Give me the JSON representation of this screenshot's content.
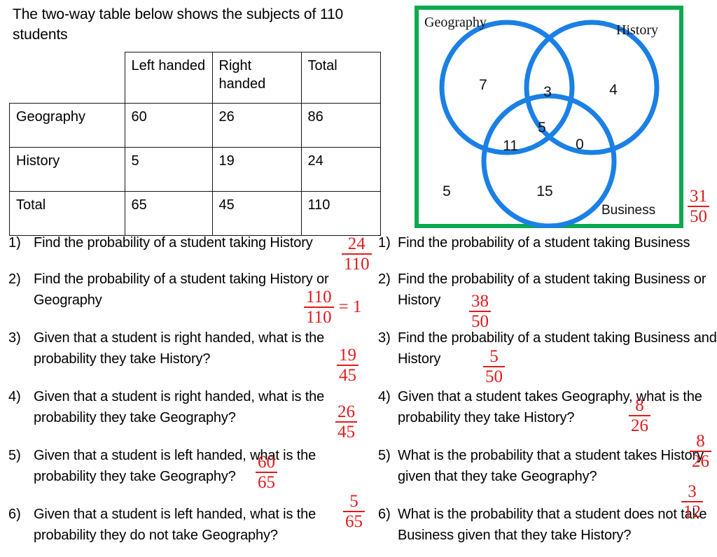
{
  "intro": {
    "text": "The two-way table below shows the subjects of 110 students"
  },
  "table": {
    "corner": "",
    "columns": [
      "Left handed",
      "Right handed",
      "Total"
    ],
    "col_left": "Left handed",
    "col_right": "Right handed",
    "col_total": "Total",
    "rows": [
      {
        "label": "Geography",
        "left": "60",
        "right": "26",
        "total": "86"
      },
      {
        "label": "History",
        "left": "5",
        "right": "19",
        "total": "24"
      },
      {
        "label": "Total",
        "left": "65",
        "right": "45",
        "total": "110"
      }
    ]
  },
  "venn": {
    "border_color": "#0da94f",
    "circle_color": "#1a80e5",
    "labels": {
      "geography": "Geography",
      "history": "History",
      "business": "Business"
    },
    "regions": {
      "geography_only": "7",
      "geography_history": "3",
      "history_only": "4",
      "all_three": "5",
      "geography_business": "11",
      "history_business": "0",
      "business_only": "15",
      "outside": "5"
    },
    "side_answer": {
      "num": "31",
      "den": "50"
    }
  },
  "answer_color": "#e01b1b",
  "questions_left": [
    {
      "num": "1)",
      "text": "Find the probability of a student taking History",
      "answer": {
        "num": "24",
        "den": "110"
      }
    },
    {
      "num": "2)",
      "text": "Find the probability of a student taking History or Geography",
      "answer": {
        "num": "110",
        "den": "110",
        "equals": "= 1"
      }
    },
    {
      "num": "3)",
      "text": "Given that a student is right handed, what is the probability they take History?",
      "answer": {
        "num": "19",
        "den": "45"
      }
    },
    {
      "num": "4)",
      "text": "Given that a student is right handed, what is the probability they take Geography?",
      "answer": {
        "num": "26",
        "den": "45"
      }
    },
    {
      "num": "5)",
      "text": "Given that a student is left handed, what is the probability they take Geography?",
      "answer": {
        "num": "60",
        "den": "65"
      }
    },
    {
      "num": "6)",
      "text": "Given that a student is left handed, what is the probability they do not take Geography?",
      "answer": {
        "num": "5",
        "den": "65"
      }
    }
  ],
  "questions_right": [
    {
      "num": "1)",
      "text": "Find the probability of a student taking Business",
      "answer": null
    },
    {
      "num": "2)",
      "text": "Find the probability of a student taking Business or History",
      "answer": {
        "num": "38",
        "den": "50"
      }
    },
    {
      "num": "3)",
      "text": "Find the probability of a student taking Business and History",
      "answer": {
        "num": "5",
        "den": "50"
      }
    },
    {
      "num": "4)",
      "text": "Given that a student takes Geography, what is the probability they take History?",
      "answer": {
        "num": "8",
        "den": "26"
      }
    },
    {
      "num": "5)",
      "text": "What is the probability that a student takes History given that they take Geography?",
      "answer": {
        "num": "8",
        "den": "26"
      }
    },
    {
      "num": "6)",
      "text": "What is the probability that a student does not take Business given that they take History?",
      "answer": {
        "num": "3",
        "den": "12"
      }
    }
  ]
}
